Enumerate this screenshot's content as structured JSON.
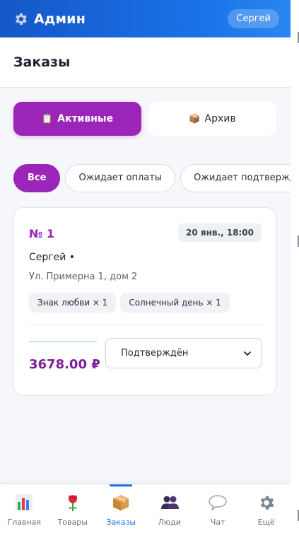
{
  "header": {
    "title": "Админ",
    "user": "Сергей",
    "icon": "gear-icon"
  },
  "page": {
    "title": "Заказы"
  },
  "tabs": [
    {
      "label": "Активные",
      "emoji": "📋",
      "active": true
    },
    {
      "label": "Архив",
      "emoji": "📦",
      "active": false
    }
  ],
  "filters": [
    {
      "label": "Все",
      "active": true
    },
    {
      "label": "Ожидает оплаты",
      "active": false
    },
    {
      "label": "Ожидает подтверждения",
      "active": false
    }
  ],
  "order": {
    "number": "№ 1",
    "date": "20 янв., 18:00",
    "customer": "Сергей •",
    "address": "Ул. Примерна 1, дом 2",
    "items": [
      "Знак любви × 1",
      "Солнечный день × 1"
    ],
    "total": "3678.00 ₽",
    "status": "Подтверждён",
    "accent_color": "#9b25b8"
  },
  "nav": [
    {
      "label": "Главная",
      "icon": "chart-icon",
      "active": false
    },
    {
      "label": "Товары",
      "icon": "rose-icon",
      "active": false
    },
    {
      "label": "Заказы",
      "icon": "package-icon",
      "active": true
    },
    {
      "label": "Люди",
      "icon": "people-icon",
      "active": false
    },
    {
      "label": "Чат",
      "icon": "chat-bubble-icon",
      "active": false
    },
    {
      "label": "Ещё",
      "icon": "gear-icon",
      "active": false
    }
  ],
  "colors": {
    "header": "#1a73e8",
    "accent": "#9b25b8",
    "nav_active": "#1a73e8"
  }
}
